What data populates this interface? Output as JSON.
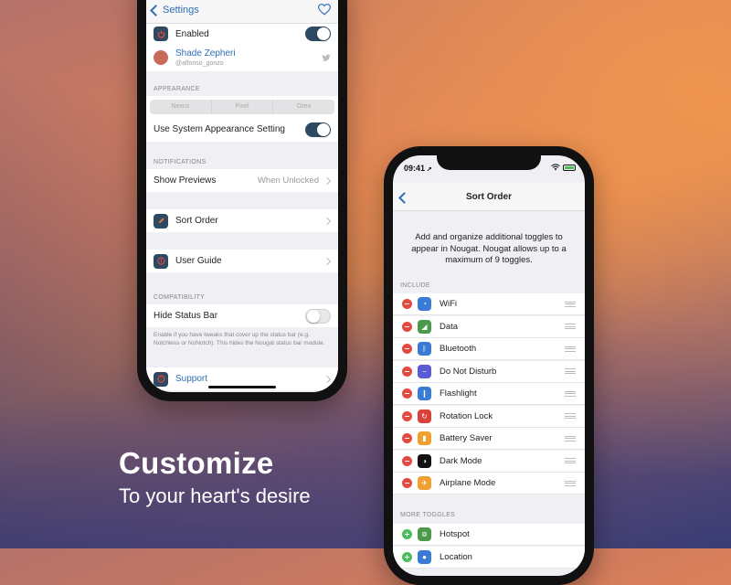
{
  "caption": {
    "title": "Customize",
    "subtitle": "To your heart's desire"
  },
  "phone1": {
    "nav": {
      "back_label": "Settings",
      "right_icon": "heart-icon"
    },
    "enabled": {
      "label": "Enabled",
      "toggle": "on"
    },
    "author": {
      "name": "Shade Zepheri",
      "handle": "@alfonso_gonzo",
      "icon": "twitter-icon"
    },
    "appearance": {
      "header": "APPEARANCE",
      "segments": [
        "Nexus",
        "Pixel",
        "Oreo"
      ],
      "system_setting_label": "Use System Appearance Setting",
      "system_toggle": "on"
    },
    "notifications": {
      "header": "NOTIFICATIONS",
      "label": "Show Previews",
      "value": "When Unlocked"
    },
    "sort_order": {
      "label": "Sort Order",
      "icon": "pencil-icon"
    },
    "user_guide": {
      "label": "User Guide",
      "icon": "info-icon"
    },
    "compatibility": {
      "header": "COMPATIBILITY",
      "label": "Hide Status Bar",
      "toggle": "off",
      "footnote": "Enable if you have tweaks that cover up the status bar (e.g. Notchless or NoNotch). This hides the Nougat status bar module."
    },
    "support": {
      "label": "Support",
      "icon": "question-icon"
    }
  },
  "phone2": {
    "status": {
      "time": "09:41"
    },
    "nav": {
      "title": "Sort Order"
    },
    "description": "Add and organize additional toggles to appear in Nougat. Nougat allows up to a maximum of 9 toggles.",
    "include_header": "INCLUDE",
    "include": [
      {
        "label": "WiFi",
        "icon": "wifi-icon",
        "color": "#3a7bd5"
      },
      {
        "label": "Data",
        "icon": "cellular-icon",
        "color": "#4a9a4a"
      },
      {
        "label": "Bluetooth",
        "icon": "bluetooth-icon",
        "color": "#3a7bd5"
      },
      {
        "label": "Do Not Disturb",
        "icon": "moon-icon",
        "color": "#5b5bd6"
      },
      {
        "label": "Flashlight",
        "icon": "flashlight-icon",
        "color": "#3a7bd5"
      },
      {
        "label": "Rotation Lock",
        "icon": "rotation-lock-icon",
        "color": "#d9413a"
      },
      {
        "label": "Battery Saver",
        "icon": "battery-icon",
        "color": "#f0a030"
      },
      {
        "label": "Dark Mode",
        "icon": "dark-mode-icon",
        "color": "#111111"
      },
      {
        "label": "Airplane Mode",
        "icon": "airplane-icon",
        "color": "#f0a030"
      }
    ],
    "more_header": "MORE TOGGLES",
    "more": [
      {
        "label": "Hotspot",
        "icon": "hotspot-icon",
        "color": "#4a9a4a"
      },
      {
        "label": "Location",
        "icon": "location-icon",
        "color": "#3a7bd5"
      }
    ]
  }
}
